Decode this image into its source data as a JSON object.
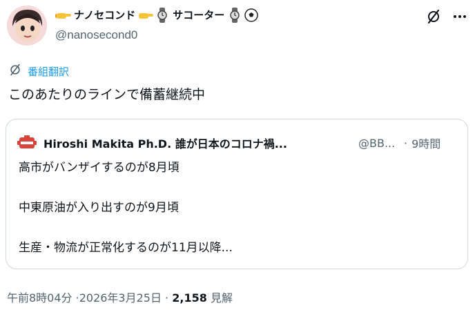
{
  "author": {
    "display_name_parts": [
      "ナノセコンド",
      "サコーター"
    ],
    "handle": "@nanosecond0"
  },
  "header_icons": [
    "grok-icon",
    "more-icon"
  ],
  "translate": {
    "label": "番組翻訳"
  },
  "tweet": {
    "text": "このあたりのラインで備蓄継続中"
  },
  "quote": {
    "author_name": "Hiroshi Makita Ph.D. 誰が日本のコロナ禍...",
    "author_handle": "@BB...",
    "separator": "·",
    "time": "9時間",
    "lines": [
      "高市がバンザイするのが8月頃",
      "中東原油が入り出すのが9月頃",
      "生産・物流が正常化するのが11月以降..."
    ]
  },
  "meta": {
    "timestamp": "午前8時04分 ·2026年3月25日 ·",
    "views_count": "2,158",
    "views_label": "見解"
  },
  "colors": {
    "accent": "#1d9bf0",
    "secondary_text": "#536471",
    "border": "#cfd9de"
  }
}
